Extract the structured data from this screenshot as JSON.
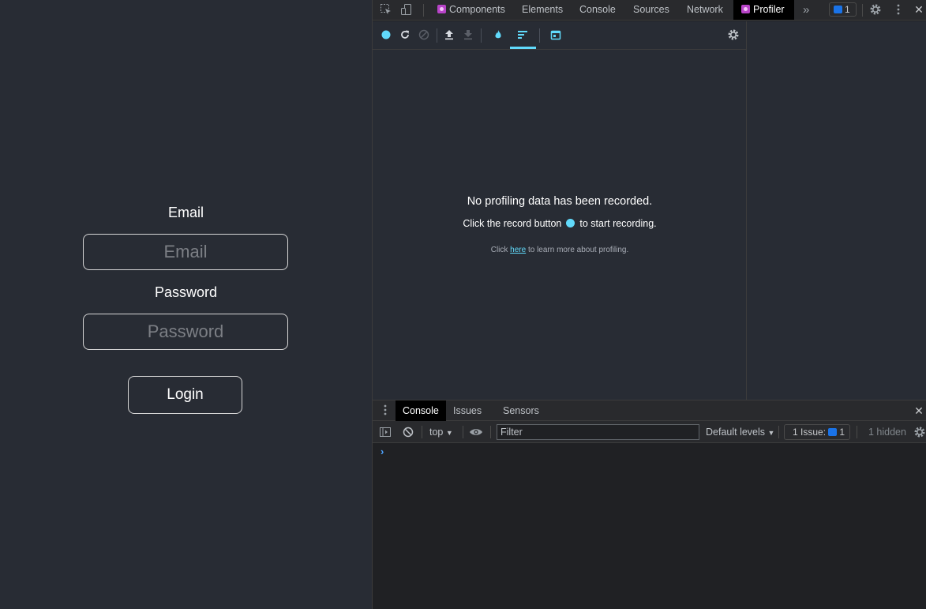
{
  "app": {
    "email_label": "Email",
    "email_placeholder": "Email",
    "password_label": "Password",
    "password_placeholder": "Password",
    "login_label": "Login"
  },
  "devtools": {
    "tabs": [
      "Components",
      "Elements",
      "Console",
      "Sources",
      "Network",
      "Profiler"
    ],
    "active_tab": "Profiler",
    "more_tabs": "»",
    "issues_badge_count": "1",
    "close": "✕"
  },
  "profiler": {
    "no_data": "No profiling data has been recorded.",
    "click_record_pre": "Click the record button",
    "click_record_post": "to start recording.",
    "learn_pre": "Click",
    "learn_link": "here",
    "learn_post": "to learn more about profiling."
  },
  "drawer": {
    "tabs": [
      "Console",
      "Issues",
      "Sensors"
    ],
    "active_tab": "Console",
    "context": "top",
    "filter_placeholder": "Filter",
    "levels": "Default levels",
    "issue_label": "1 Issue:",
    "issue_count": "1",
    "hidden": "1 hidden",
    "prompt": "›"
  },
  "colors": {
    "react_accent": "#61dafb",
    "app_bg": "#282c34",
    "link": "#61dafb"
  }
}
